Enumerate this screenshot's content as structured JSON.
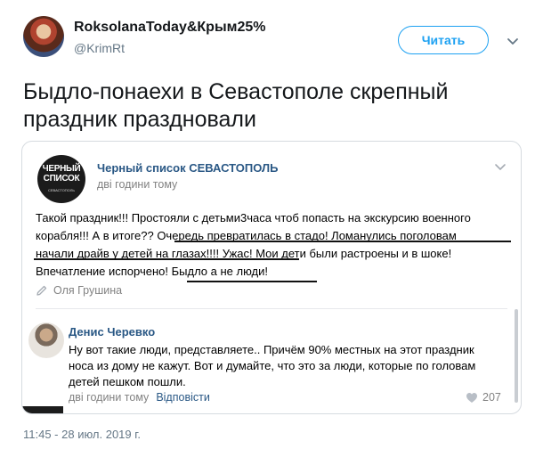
{
  "tweet": {
    "display_name": "RoksolanaToday&Крым25%",
    "handle": "@KrimRt",
    "follow_label": "Читать",
    "text": "Быдло-понаехи в Севастополе скрепный праздник праздновали",
    "timestamp": "11:45 - 28 июл. 2019 г."
  },
  "embedded_post": {
    "avatar_text_line1": "ЧЕРНЫЙ",
    "avatar_text_line2": "СПИСОК",
    "avatar_text_line3": "СЕВАСТОПОЛЬ",
    "group_name": "Черный список СЕВАСТОПОЛЬ",
    "time": "дві години тому",
    "body_line1": "Такой праздник!!! Простояли с детьми3часа чтоб попасть на экскурсию военного",
    "body_line2": "корабля!!! А в итоге?? Очередь превратилась в стадо! Ломанулись поголовам",
    "body_line3": "начали драйв у детей на глазах!!!! Ужас! Мои дети были растроены и в шоке!",
    "body_line4": "Впечатление испорчено! Быдло а не люди!",
    "author": "Оля Грушина",
    "comment": {
      "name": "Денис Черевко",
      "line1": "Ну вот такие люди, представляете.. Причём 90% местных на этот праздник",
      "line2": "носа из дому не кажут. Вот и думайте, что это за люди, которые по головам",
      "line3": "детей пешком пошли.",
      "time": "дві години тому",
      "reply_label": "Відповісти",
      "likes": "207"
    }
  },
  "icons": {
    "caret": "chevron-down-icon",
    "edit": "pencil-icon",
    "like": "heart-icon"
  },
  "colors": {
    "twitter_blue": "#1da1f2",
    "vk_link": "#2a5885",
    "muted": "#828282"
  }
}
